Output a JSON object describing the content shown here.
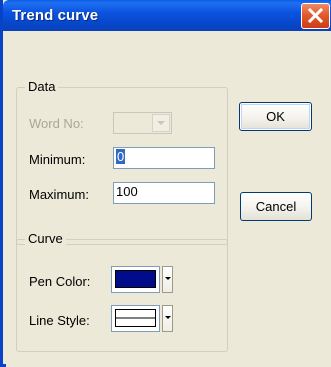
{
  "window": {
    "title": "Trend curve"
  },
  "data_group": {
    "title": "Data",
    "word_no_label": "Word No:",
    "word_no_value": "",
    "minimum_label": "Minimum:",
    "minimum_value": "0",
    "maximum_label": "Maximum:",
    "maximum_value": "100"
  },
  "curve_group": {
    "title": "Curve",
    "pen_color_label": "Pen Color:",
    "pen_color": "#000c8a",
    "line_style_label": "Line Style:",
    "line_style_color": "#ffffff"
  },
  "buttons": {
    "ok": "OK",
    "cancel": "Cancel"
  },
  "icons": {
    "close": "close-icon",
    "dropdown": "chevron-down-icon"
  },
  "colors": {
    "titlebar": "#0a4fd8",
    "dialog_bg": "#ece9d8",
    "close_button": "#e35a2f",
    "disabled_text": "#a8a797"
  }
}
